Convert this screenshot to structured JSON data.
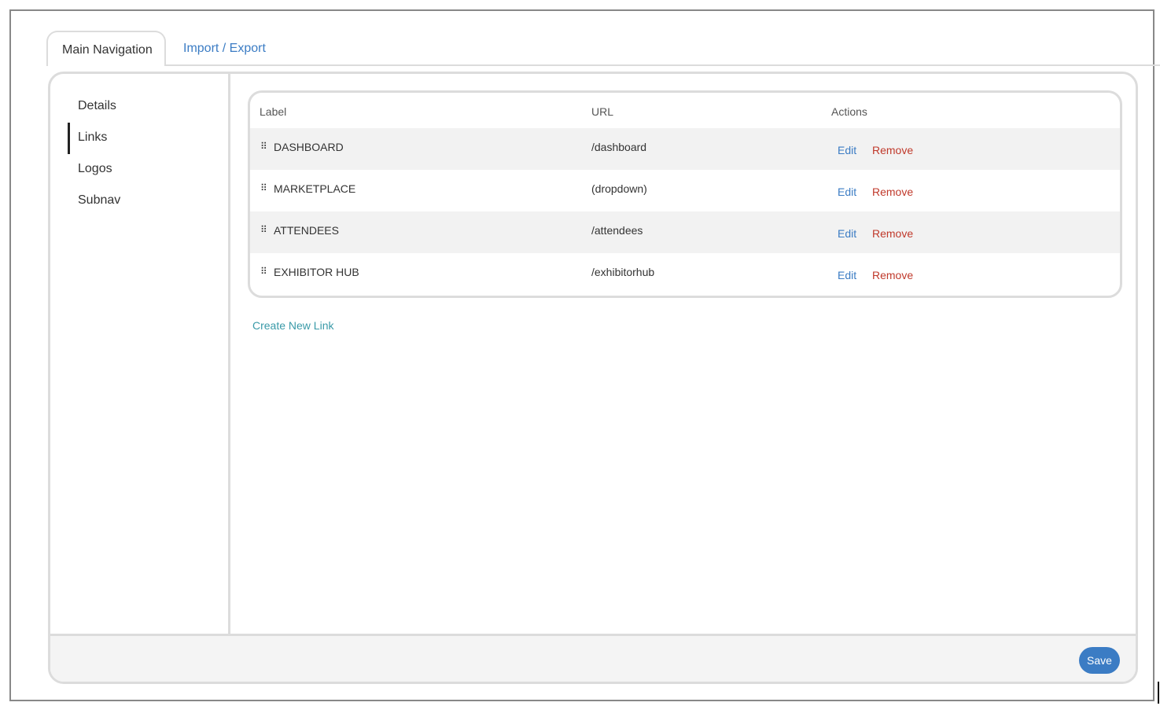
{
  "tabs": [
    {
      "label": "Main Navigation",
      "active": true
    },
    {
      "label": "Import / Export",
      "active": false
    }
  ],
  "sidebar": {
    "items": [
      {
        "label": "Details"
      },
      {
        "label": "Links",
        "active": true
      },
      {
        "label": "Logos"
      },
      {
        "label": "Subnav"
      }
    ]
  },
  "table": {
    "headers": {
      "label": "Label",
      "url": "URL",
      "actions": "Actions"
    },
    "rows": [
      {
        "label": "DASHBOARD",
        "url": "/dashboard",
        "edit": "Edit",
        "remove": "Remove"
      },
      {
        "label": "MARKETPLACE",
        "url": "(dropdown)",
        "edit": "Edit",
        "remove": "Remove"
      },
      {
        "label": "ATTENDEES",
        "url": "/attendees",
        "edit": "Edit",
        "remove": "Remove"
      },
      {
        "label": "EXHIBITOR HUB",
        "url": "/exhibitorhub",
        "edit": "Edit",
        "remove": "Remove"
      }
    ]
  },
  "create_link_label": "Create New Link",
  "footer": {
    "save_label": "Save"
  },
  "icons": {
    "drag_handle": "drag-handle-icon"
  },
  "colors": {
    "link": "#3b7cc4",
    "danger": "#c0392b",
    "create_link": "#3a9aa8",
    "save_button": "#3b7cc4",
    "border": "#dcdcdc"
  }
}
